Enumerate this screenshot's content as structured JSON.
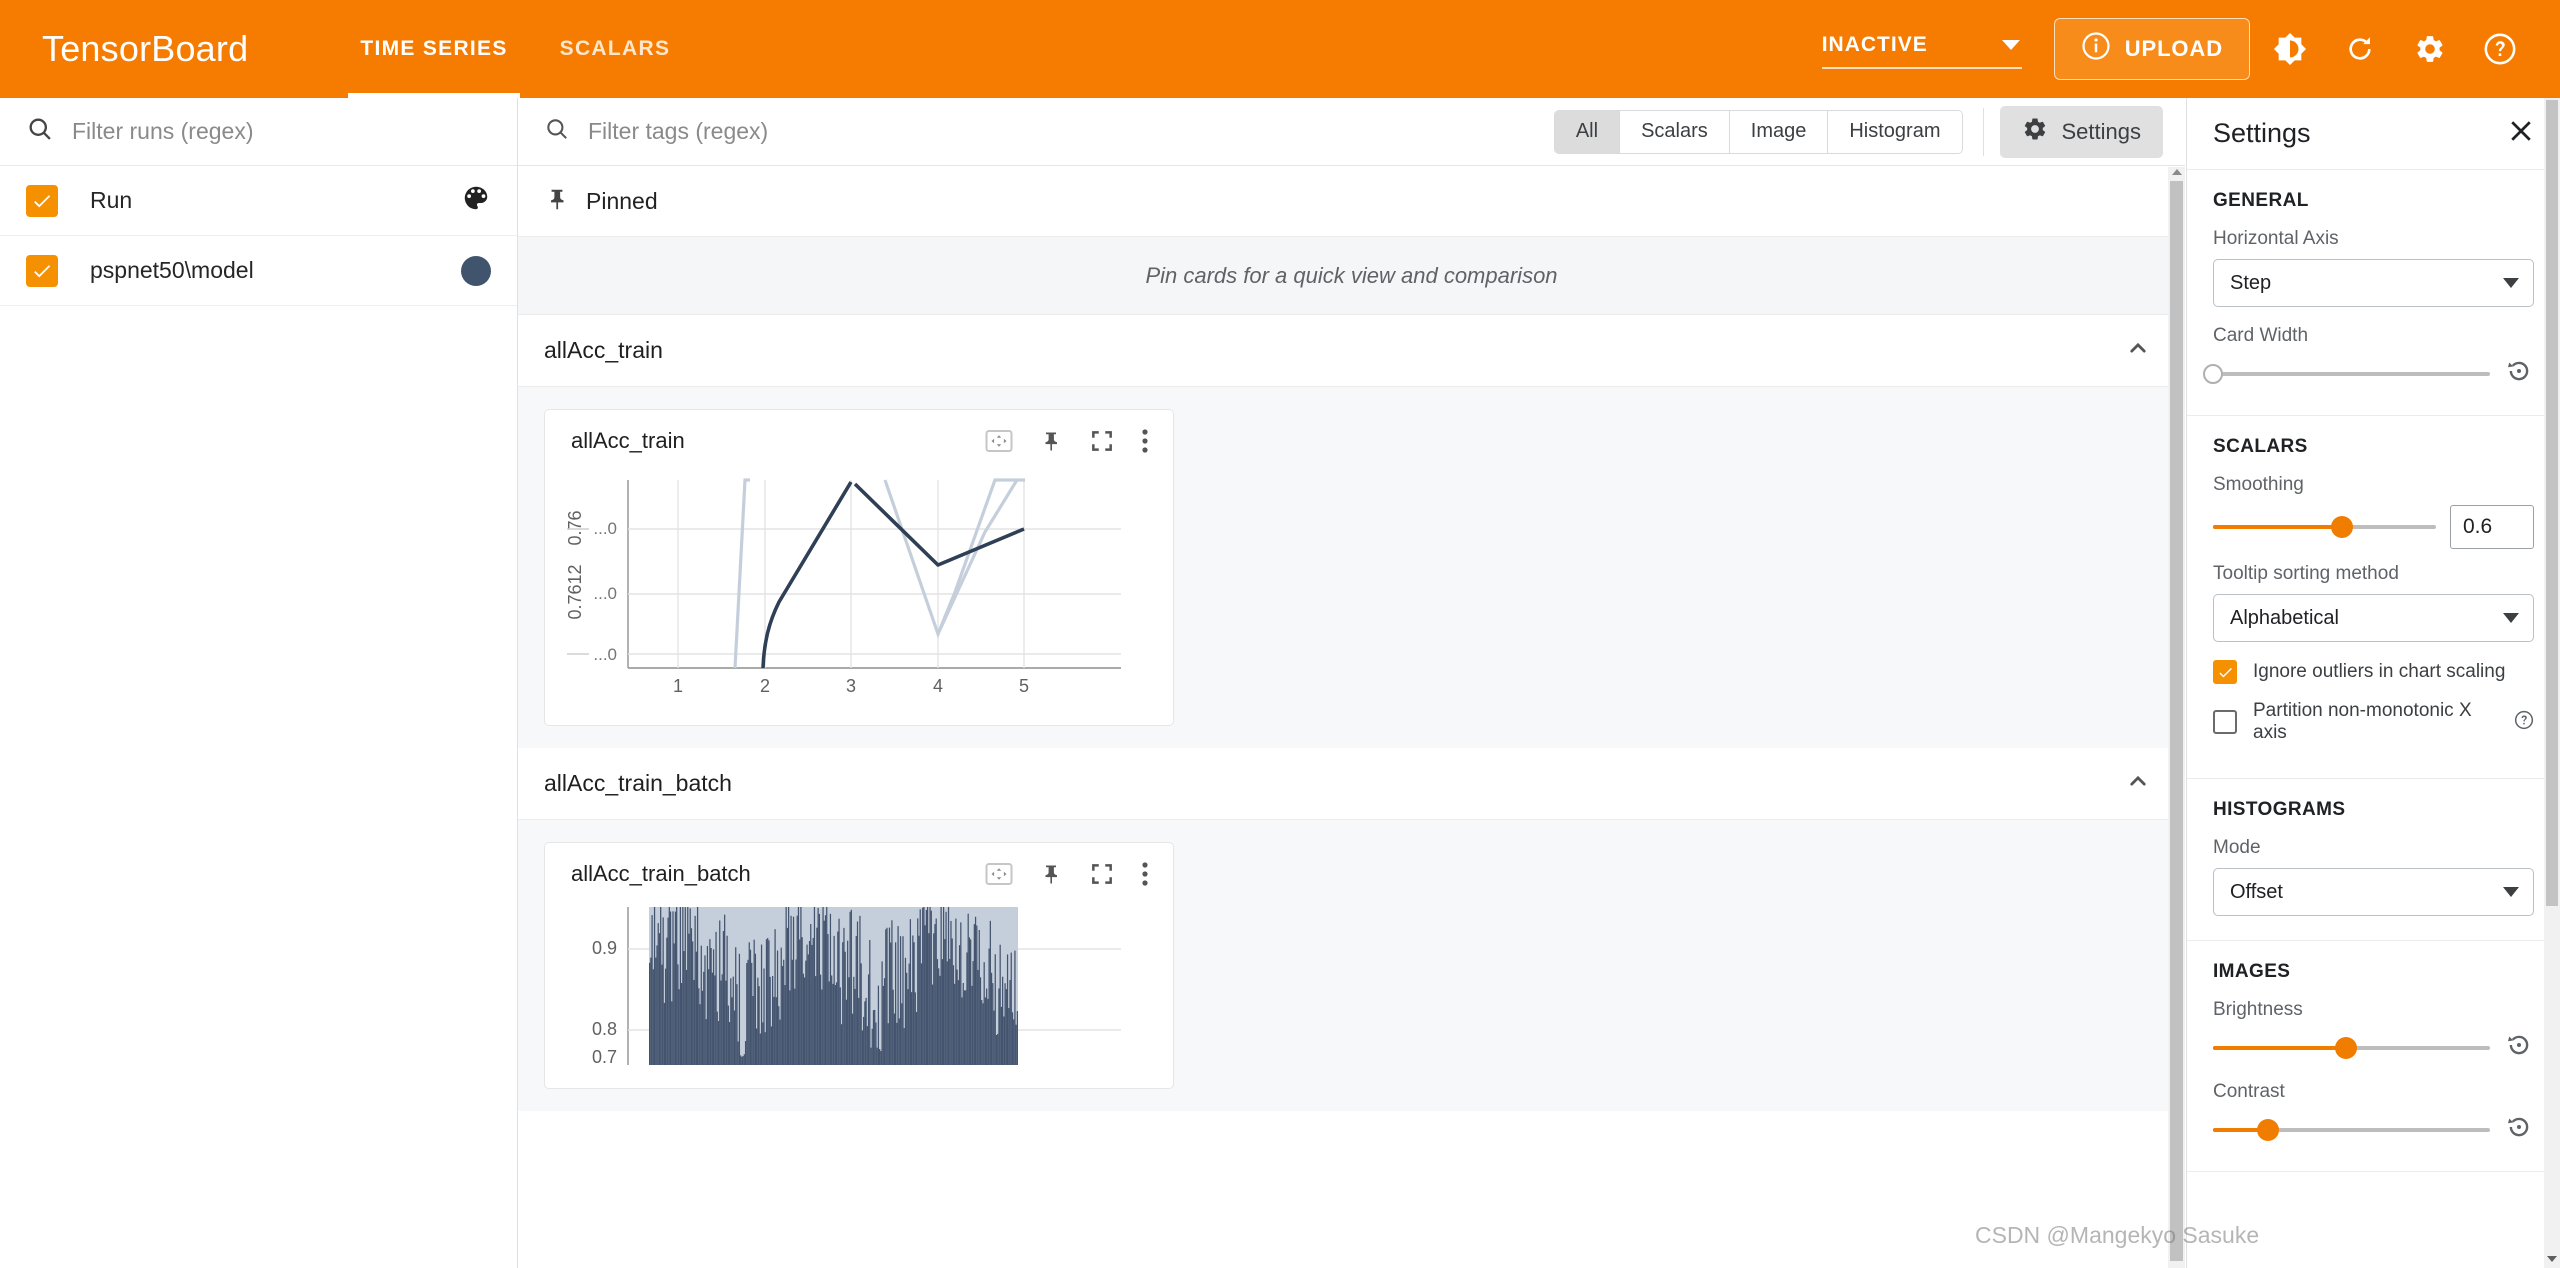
{
  "appbar": {
    "brand": "TensorBoard",
    "tabs": [
      {
        "label": "TIME SERIES",
        "active": true
      },
      {
        "label": "SCALARS",
        "active": false
      }
    ],
    "status_select": "INACTIVE",
    "upload_label": "UPLOAD",
    "icons": [
      "info-icon",
      "brightness-icon",
      "reload-icon",
      "gear-icon",
      "help-icon"
    ],
    "accent_color": "#f57c00"
  },
  "sidebar": {
    "filter_placeholder": "Filter runs (regex)",
    "runs": [
      {
        "label": "Run",
        "checked": true,
        "marker": "palette-icon"
      },
      {
        "label": "pspnet50\\model",
        "checked": true,
        "marker": "color-swatch",
        "color": "#41546e"
      }
    ]
  },
  "main": {
    "tag_filter_placeholder": "Filter tags (regex)",
    "toggles": [
      {
        "label": "All",
        "selected": true
      },
      {
        "label": "Scalars",
        "selected": false
      },
      {
        "label": "Image",
        "selected": false
      },
      {
        "label": "Histogram",
        "selected": false
      }
    ],
    "settings_button": "Settings",
    "pinned": {
      "header": "Pinned",
      "empty_message": "Pin cards for a quick view and comparison"
    },
    "groups": [
      {
        "title": "allAcc_train",
        "card_title": "allAcc_train"
      },
      {
        "title": "allAcc_train_batch",
        "card_title": "allAcc_train_batch"
      }
    ]
  },
  "settings": {
    "title": "Settings",
    "general": {
      "heading": "GENERAL",
      "horizontal_axis_label": "Horizontal Axis",
      "horizontal_axis_value": "Step",
      "card_width_label": "Card Width",
      "card_width_value": "0"
    },
    "scalars": {
      "heading": "SCALARS",
      "smoothing_label": "Smoothing",
      "smoothing_value": "0.6",
      "tooltip_sorting_label": "Tooltip sorting method",
      "tooltip_sorting_value": "Alphabetical",
      "ignore_outliers_label": "Ignore outliers in chart scaling",
      "ignore_outliers_checked": true,
      "partition_label": "Partition non-monotonic X axis",
      "partition_checked": false
    },
    "histograms": {
      "heading": "HISTOGRAMS",
      "mode_label": "Mode",
      "mode_value": "Offset"
    },
    "images": {
      "heading": "IMAGES",
      "brightness_label": "Brightness",
      "brightness_value": "0.5",
      "contrast_label": "Contrast",
      "contrast_value": "0.2"
    }
  },
  "watermark": "CSDN @Mangekyo Sasuke",
  "chart_data": [
    {
      "type": "line",
      "title": "allAcc_train",
      "xlabel": "",
      "ylabel": "",
      "x_ticks": [
        "1",
        "2",
        "3",
        "4",
        "5"
      ],
      "y_axis_labels": [
        "0.76",
        "0.7612"
      ],
      "y_tick_labels": [
        "...0",
        "...0",
        "...0"
      ],
      "xlim": [
        0.5,
        5.5
      ],
      "series": [
        {
          "name": "pspnet50\\model (smoothed)",
          "color": "#2e3f56",
          "x": [
            1.92,
            2.0,
            2.5,
            3.0,
            4.0,
            5.0
          ],
          "y": [
            0.0,
            0.06,
            0.42,
            1.02,
            0.62,
            0.82
          ]
        },
        {
          "name": "pspnet50\\model (raw)",
          "color": "#c5cfdc",
          "x": [
            1.6,
            1.72,
            3.5,
            4.0,
            4.95
          ],
          "y": [
            0.0,
            1.05,
            1.02,
            0.12,
            1.05
          ]
        }
      ]
    },
    {
      "type": "area",
      "title": "allAcc_train_batch",
      "xlabel": "",
      "ylabel": "",
      "y_ticks": [
        "0.9",
        "0.8",
        "0.7"
      ],
      "ylim": [
        0.65,
        0.96
      ],
      "series": [
        {
          "name": "pspnet50\\model (raw)",
          "color": "#c5cfdc"
        },
        {
          "name": "pspnet50\\model (smoothed)",
          "color": "#44546e"
        }
      ]
    }
  ]
}
